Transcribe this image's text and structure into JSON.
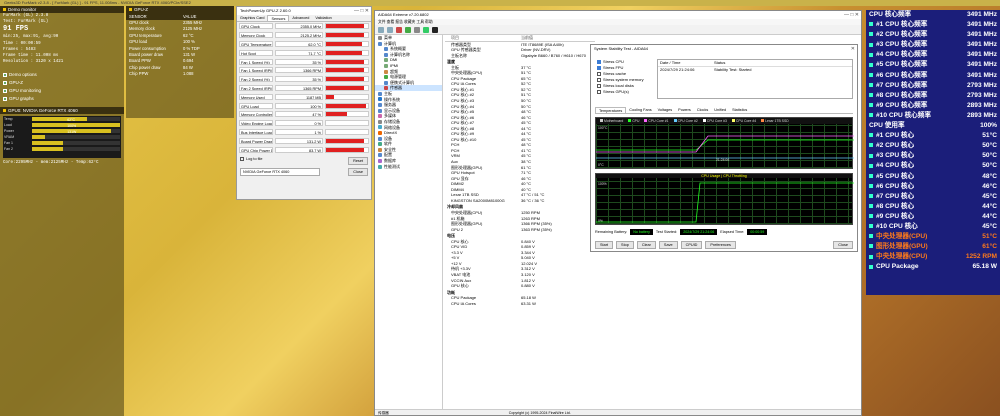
{
  "window_title": "Geeks3D FurMark v2.3.8 - [ FurMark (GL) ] - 91 FPS, 11.008ms - NVIDIA GeForce RTX 4060/PCIe/SSE2",
  "fm_panel": {
    "title": "Demo monitor",
    "lines": [
      "FurMark (GL) 2.3.8",
      "Test: FurMark (GL)"
    ],
    "fps": "91 FPS",
    "stats": [
      "min:25, max:91, avg:90",
      "Time    : 00:00:59",
      "Frames  : 5483",
      "Frame time : 11.008 ms",
      "Resolution : 3120 x 1421"
    ],
    "options": [
      "Demo options",
      "GPU-Z",
      "GPU monitoring",
      "GPU graphs"
    ],
    "gpu_label": "GPU0: NVIDIA GeForce RTX 4060",
    "mini": [
      {
        "l": "Temp",
        "v": "62°C",
        "pct": 0.62
      },
      {
        "l": "Load",
        "v": "100%",
        "pct": 1.0
      },
      {
        "l": "Power",
        "v": "131W",
        "pct": 0.9
      },
      {
        "l": "VRAM",
        "v": "",
        "pct": 0.15
      },
      {
        "l": "Fan 1",
        "v": "",
        "pct": 0.35
      },
      {
        "l": "Fan 2",
        "v": "",
        "pct": 0.35
      }
    ],
    "footer": "Core:2295MHz - mem:2125MHz - Temp:62°C"
  },
  "gpu2": {
    "title": "GPU-Z",
    "headers": [
      "SENSOR",
      "VALUE"
    ],
    "rows": [
      [
        "GPU clock",
        "2355 MHz"
      ],
      [
        "Memory clock",
        "2125 MHz"
      ],
      [
        "GPU temperature",
        "62 °C"
      ],
      [
        "GPU load",
        "100 %"
      ],
      [
        "Power consumption",
        "0 % TDP"
      ],
      [
        "Board power draw",
        "131 W"
      ],
      [
        "Board PPW",
        "0.694"
      ],
      [
        "Chip power draw",
        "84 W"
      ],
      [
        "Chip PPW",
        "1.088"
      ]
    ]
  },
  "gpuz": {
    "title": "TechPowerUp GPU-Z 2.60.0",
    "tabs": [
      "Graphics Card",
      "Sensors",
      "Advanced",
      "Validation"
    ],
    "rows": [
      [
        "GPU Clock",
        "2355.0 MHz",
        0.9
      ],
      [
        "Memory Clock",
        "2125.2 MHz",
        0.9
      ],
      [
        "GPU Temperature",
        "62.0 °C",
        0.85
      ],
      [
        "Hot Spot",
        "71.7 °C",
        0.85
      ],
      [
        "Fan 1 Speed (%)",
        "35 %",
        0.9
      ],
      [
        "Fan 1 Speed (RPM)",
        "1366 RPM",
        0.9
      ],
      [
        "Fan 2 Speed (%)",
        "35 %",
        0.9
      ],
      [
        "Fan 2 Speed (RPM)",
        "1365 RPM",
        0.9
      ],
      [
        "Memory Used",
        "1187 MB",
        0.2
      ],
      [
        "GPU Load",
        "100 %",
        0.95
      ],
      [
        "Memory Controller Load",
        "47 %",
        0.5
      ],
      [
        "Video Engine Load",
        "0 %",
        0
      ],
      [
        "Bus Interface Load",
        "1 %",
        0
      ],
      [
        "Board Power Draw",
        "131.2 W",
        0.9
      ],
      [
        "GPU Chip Power Draw",
        "83.7 W",
        0.9
      ]
    ],
    "log": "Log to file",
    "reset": "Reset",
    "device": "NVIDIA GeForce RTX 4060",
    "close": "Close"
  },
  "aida": {
    "title": "AIDA64 Extreme v7.20.6802",
    "menu": "文件  查看  报告  收藏夹  工具  帮助",
    "tree": [
      "菜单",
      "计算机",
      "系统概要",
      "计算机名称",
      "DMI",
      "IPMI",
      "超频",
      "电源管理",
      "便携式计算机",
      "传感器",
      "主板",
      "操作系统",
      "服务器",
      "显示设备",
      "多媒体",
      "存储设备",
      "网络设备",
      "DirectX",
      "设备",
      "软件",
      "安全性",
      "配置",
      "数据库",
      "性能测试"
    ],
    "cols": [
      "项目",
      "当前值"
    ],
    "sensor_props": [
      [
        "传感器类型",
        "ITE IT8689E (ISA A40h)"
      ],
      [
        "GPU 传感器类型",
        "Driver (NV-DRV)"
      ],
      [
        "主板名称",
        "Gigabyte B660 / B760 / H610 / H670"
      ]
    ],
    "temps_title": "温度",
    "temps": [
      [
        "主板",
        "37 °C"
      ],
      [
        "中央处理器(CPU)",
        "51 °C"
      ],
      [
        "CPU Package",
        "65 °C"
      ],
      [
        "CPU IA Cores",
        "52 °C"
      ],
      [
        "CPU 核心 #1",
        "52 °C"
      ],
      [
        "CPU 核心 #2",
        "51 °C"
      ],
      [
        "CPU 核心 #3",
        "50 °C"
      ],
      [
        "CPU 核心 #4",
        "50 °C"
      ],
      [
        "CPU 核心 #5",
        "48 °C"
      ],
      [
        "CPU 核心 #6",
        "46 °C"
      ],
      [
        "CPU 核心 #7",
        "45 °C"
      ],
      [
        "CPU 核心 #8",
        "44 °C"
      ],
      [
        "CPU 核心 #9",
        "44 °C"
      ],
      [
        "CPU 核心 #10",
        "45 °C"
      ],
      [
        "PCH",
        "48 °C"
      ],
      [
        "PCH",
        "41 °C"
      ],
      [
        "VRM",
        "45 °C"
      ],
      [
        "Aux",
        "38 °C"
      ],
      [
        "图形处理器(GPU)",
        "61 °C"
      ],
      [
        "GPU Hotspot",
        "71 °C"
      ],
      [
        "GPU 显存",
        "46 °C"
      ],
      [
        "DIMM2",
        "40 °C"
      ],
      [
        "DIMM4",
        "40 °C"
      ],
      [
        "Lexar 1TB SSD",
        "47 °C / 51 °C"
      ],
      [
        "KINGSTON SA2000M81000G",
        "36 °C / 36 °C"
      ]
    ],
    "fans_title": "冷却风扇",
    "fans": [
      [
        "中央处理器(CPU)",
        "1250 RPM"
      ],
      [
        "#1 机箱",
        "1263 RPM"
      ],
      [
        "图形处理器(GPU)",
        "1366 RPM (35%)"
      ],
      [
        "GPU 2",
        "1363 RPM (35%)"
      ]
    ],
    "volt_title": "电压",
    "volts": [
      [
        "CPU 核心",
        "0.840 V"
      ],
      [
        "CPU VID",
        "0.859 V"
      ],
      [
        "+3.3 V",
        "3.344 V"
      ],
      [
        "+5 V",
        "5.040 V"
      ],
      [
        "+12 V",
        "12.024 V"
      ],
      [
        "待机 +3.3V",
        "3.312 V"
      ],
      [
        "VBAT 电池",
        "3.120 V"
      ],
      [
        "VCCIN Aux",
        "1.812 V"
      ],
      [
        "GPU 核心",
        "0.880 V"
      ]
    ],
    "power_title": "功耗",
    "powers": [
      [
        "CPU Package",
        "65.18 W"
      ],
      [
        "CPU IA Cores",
        "63.31 W"
      ]
    ],
    "status": "传感器",
    "copyright": "Copyright (c) 1995-2024 FinalWire Ltd."
  },
  "stab": {
    "title": "System Stability Test - AIDA64",
    "checks": [
      [
        "Stress CPU",
        true
      ],
      [
        "Stress FPU",
        true
      ],
      [
        "Stress cache",
        false
      ],
      [
        "Stress system memory",
        false
      ],
      [
        "Stress local disks",
        false
      ],
      [
        "Stress GPU(s)",
        false
      ]
    ],
    "log_cols": [
      "Date / Time",
      "Status"
    ],
    "log_row": [
      "2024/7/29 21:24:06",
      "Stability Test: Started"
    ],
    "tabs": [
      "Temperatures",
      "Cooling Fans",
      "Voltages",
      "Powers",
      "Clocks",
      "Unified",
      "Statistics"
    ],
    "legend": [
      "Motherboard",
      "CPU",
      "CPU Core #1",
      "CPU Core #2",
      "CPU Core #3",
      "CPU Core #4",
      "Lexar 1TB SSD"
    ],
    "g1_top": "100°C",
    "g1_bot": "0°C",
    "g1_time": "21:24:06",
    "g2_title": "CPU Usage | CPU Throttling",
    "g2_top": "100%",
    "g2_bot": "0%",
    "bottom": {
      "battery_label": "Remaining Battery:",
      "battery": "No battery",
      "started_label": "Test Started:",
      "started": "2024/7/29 21:24:06",
      "elapsed_label": "Elapsed Time:",
      "elapsed": "00:00:59"
    },
    "buttons": [
      "Start",
      "Stop",
      "Clear",
      "Save",
      "CPUID",
      "Preferences",
      "Close"
    ]
  },
  "rt": [
    [
      "CPU 核心频率",
      "3491 MHz",
      false
    ],
    [
      "#1 CPU 核心频率",
      "3491 MHz",
      true
    ],
    [
      "#2 CPU 核心频率",
      "3491 MHz",
      true
    ],
    [
      "#3 CPU 核心频率",
      "3491 MHz",
      true
    ],
    [
      "#4 CPU 核心频率",
      "3491 MHz",
      true
    ],
    [
      "#5 CPU 核心频率",
      "3491 MHz",
      true
    ],
    [
      "#6 CPU 核心频率",
      "3491 MHz",
      true
    ],
    [
      "#7 CPU 核心频率",
      "2793 MHz",
      true
    ],
    [
      "#8 CPU 核心频率",
      "2793 MHz",
      true
    ],
    [
      "#9 CPU 核心频率",
      "2893 MHz",
      true
    ],
    [
      "#10 CPU 核心频率",
      "2893 MHz",
      true
    ],
    [
      "CPU 使用率",
      "100%",
      false
    ],
    [
      "#1 CPU 核心",
      "51°C",
      true
    ],
    [
      "#2 CPU 核心",
      "50°C",
      true
    ],
    [
      "#3 CPU 核心",
      "50°C",
      true
    ],
    [
      "#4 CPU 核心",
      "50°C",
      true
    ],
    [
      "#5 CPU 核心",
      "48°C",
      true
    ],
    [
      "#6 CPU 核心",
      "46°C",
      true
    ],
    [
      "#7 CPU 核心",
      "45°C",
      true
    ],
    [
      "#8 CPU 核心",
      "44°C",
      true
    ],
    [
      "#9 CPU 核心",
      "44°C",
      true
    ],
    [
      "#10 CPU 核心",
      "45°C",
      true
    ],
    [
      "中央处理器(CPU)",
      "51°C",
      true
    ],
    [
      "图形处理器(GPU)",
      "61°C",
      true
    ],
    [
      "中央处理器(CPU)",
      "1252 RPM",
      true
    ],
    [
      "CPU Package",
      "65.18 W",
      true
    ]
  ],
  "colors": {
    "accent_red": "#e02020",
    "overlay_bg": "#1b1e7a",
    "graph_green": "#22ff22",
    "fan_orange": "#ff7a1a"
  }
}
